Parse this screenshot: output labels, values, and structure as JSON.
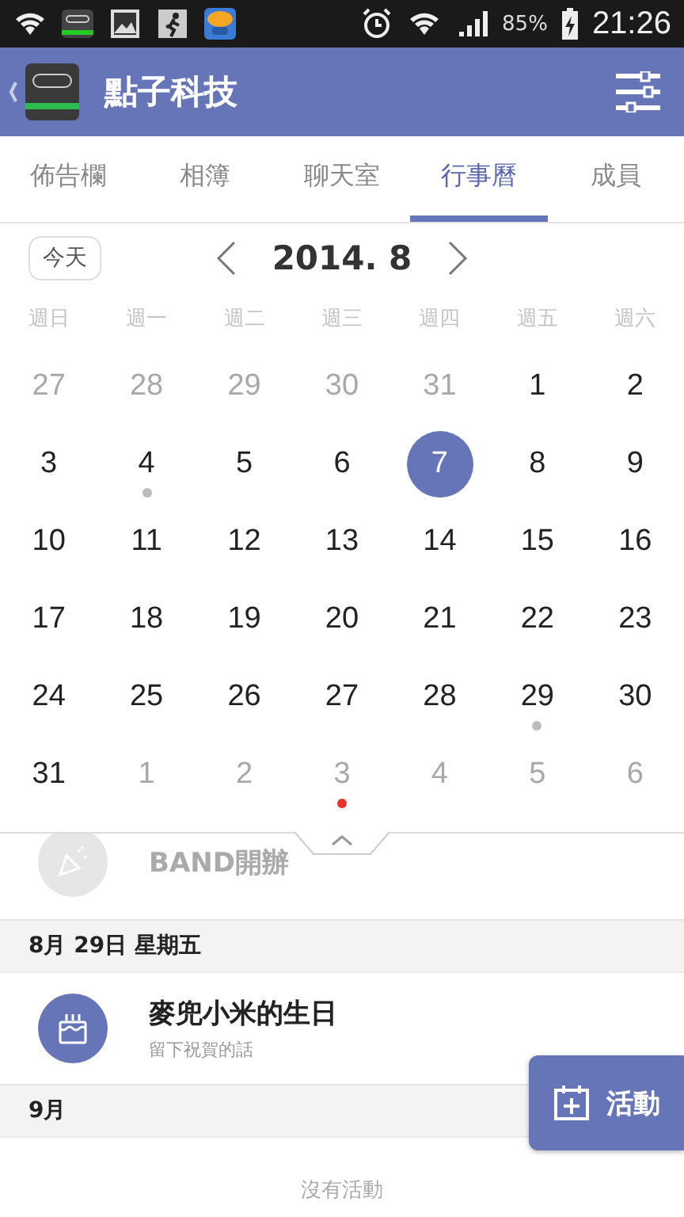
{
  "status_bar": {
    "battery": "85%",
    "time": "21:26"
  },
  "app_bar": {
    "title": "點子科技"
  },
  "tabs": [
    {
      "label": "佈告欄",
      "selected": false
    },
    {
      "label": "相簿",
      "selected": false
    },
    {
      "label": "聊天室",
      "selected": false
    },
    {
      "label": "行事曆",
      "selected": true
    },
    {
      "label": "成員",
      "selected": false
    }
  ],
  "calendar": {
    "today_button": "今天",
    "month": "2014. 8",
    "weekdays": [
      "週日",
      "週一",
      "週二",
      "週三",
      "週四",
      "週五",
      "週六"
    ],
    "days": [
      {
        "day": "27",
        "muted": true,
        "selected": false
      },
      {
        "day": "28",
        "muted": true,
        "selected": false
      },
      {
        "day": "29",
        "muted": true,
        "selected": false
      },
      {
        "day": "30",
        "muted": true,
        "selected": false
      },
      {
        "day": "31",
        "muted": true,
        "selected": false
      },
      {
        "day": "1",
        "muted": false,
        "selected": false
      },
      {
        "day": "2",
        "muted": false,
        "selected": false
      },
      {
        "day": "3",
        "muted": false,
        "selected": false
      },
      {
        "day": "4",
        "muted": false,
        "selected": false,
        "color": "#bbbbbb"
      },
      {
        "day": "5",
        "muted": false,
        "selected": false
      },
      {
        "day": "6",
        "muted": false,
        "selected": false
      },
      {
        "day": "7",
        "muted": false,
        "selected": true
      },
      {
        "day": "8",
        "muted": false,
        "selected": false
      },
      {
        "day": "9",
        "muted": false,
        "selected": false
      },
      {
        "day": "10",
        "muted": false,
        "selected": false
      },
      {
        "day": "11",
        "muted": false,
        "selected": false
      },
      {
        "day": "12",
        "muted": false,
        "selected": false
      },
      {
        "day": "13",
        "muted": false,
        "selected": false
      },
      {
        "day": "14",
        "muted": false,
        "selected": false
      },
      {
        "day": "15",
        "muted": false,
        "selected": false
      },
      {
        "day": "16",
        "muted": false,
        "selected": false
      },
      {
        "day": "17",
        "muted": false,
        "selected": false
      },
      {
        "day": "18",
        "muted": false,
        "selected": false
      },
      {
        "day": "19",
        "muted": false,
        "selected": false
      },
      {
        "day": "20",
        "muted": false,
        "selected": false
      },
      {
        "day": "21",
        "muted": false,
        "selected": false
      },
      {
        "day": "22",
        "muted": false,
        "selected": false
      },
      {
        "day": "23",
        "muted": false,
        "selected": false
      },
      {
        "day": "24",
        "muted": false,
        "selected": false
      },
      {
        "day": "25",
        "muted": false,
        "selected": false
      },
      {
        "day": "26",
        "muted": false,
        "selected": false
      },
      {
        "day": "27",
        "muted": false,
        "selected": false
      },
      {
        "day": "28",
        "muted": false,
        "selected": false
      },
      {
        "day": "29",
        "muted": false,
        "selected": false,
        "color": "#bbbbbb"
      },
      {
        "day": "30",
        "muted": false,
        "selected": false
      },
      {
        "day": "31",
        "muted": false,
        "selected": false
      },
      {
        "day": "1",
        "muted": true,
        "selected": false
      },
      {
        "day": "2",
        "muted": true,
        "selected": false
      },
      {
        "day": "3",
        "muted": true,
        "selected": false,
        "color": "#e8302c"
      },
      {
        "day": "4",
        "muted": true,
        "selected": false
      },
      {
        "day": "5",
        "muted": true,
        "selected": false
      },
      {
        "day": "6",
        "muted": true,
        "selected": false
      }
    ]
  },
  "events": [
    {
      "kind": "milestone",
      "title": "BAND開辦",
      "muted": true
    },
    {
      "kind": "header",
      "title": "8月 29日 星期五"
    },
    {
      "kind": "birthday",
      "title": "麥兜小米的生日",
      "subtitle": "留下祝賀的話",
      "muted": false
    },
    {
      "kind": "header",
      "title": "9月"
    },
    {
      "kind": "empty",
      "title": "沒有活動"
    }
  ],
  "fab": {
    "label": "活動"
  }
}
